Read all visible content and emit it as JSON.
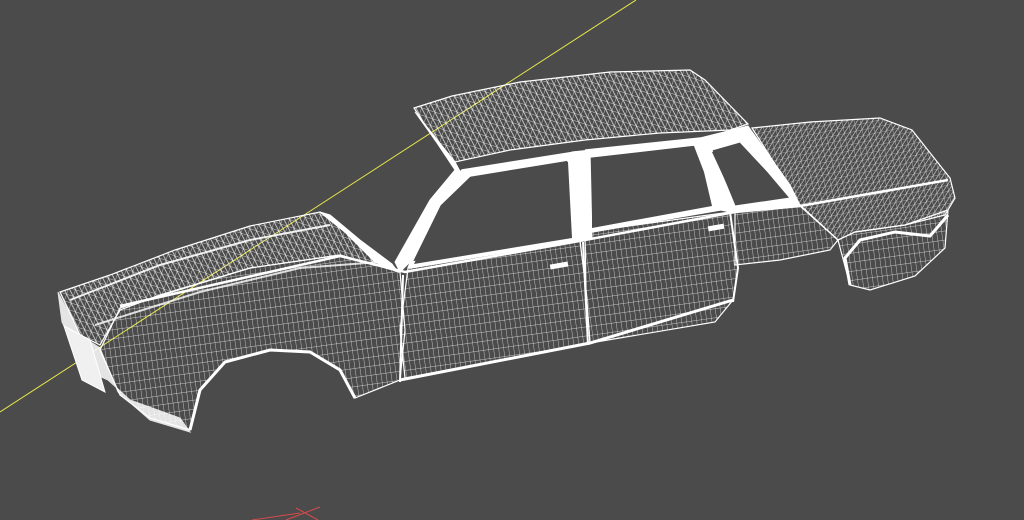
{
  "viewport": {
    "background_color": "#4b4b4b",
    "display_mode": "wireframe",
    "model": "car-body-shell",
    "mesh_color": "#ffffff",
    "axis_y_color": "#e8e84a",
    "axis_x_color": "#d94a4a",
    "axis_z_color": "#d94a4a"
  }
}
